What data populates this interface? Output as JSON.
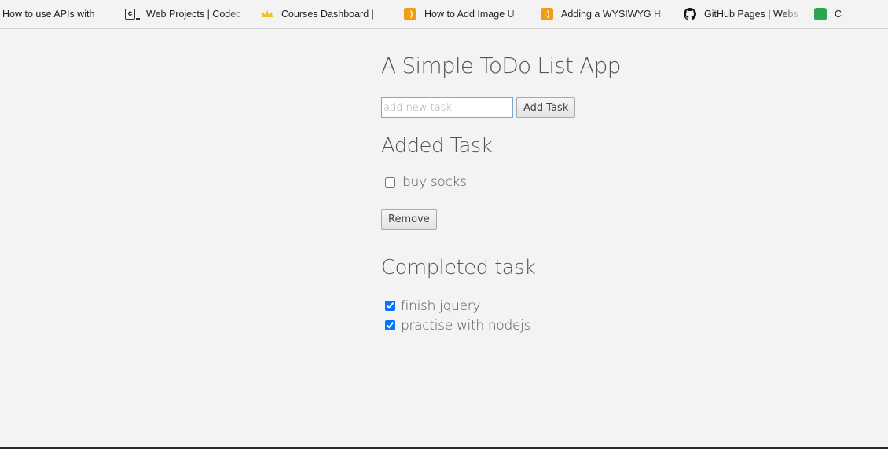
{
  "bookmarks": [
    {
      "label": "How to use APIs with",
      "icon": "none"
    },
    {
      "label": "Web Projects | Codec",
      "icon": "codecademy-icon"
    },
    {
      "label": "Courses Dashboard |",
      "icon": "crown-icon"
    },
    {
      "label": "How to Add Image U",
      "icon": "orange-bracket-icon"
    },
    {
      "label": "Adding a WYSIWYG H",
      "icon": "orange-bracket-icon"
    },
    {
      "label": "GitHub Pages | Webs",
      "icon": "github-icon"
    },
    {
      "label": "C",
      "icon": "green-bracket-icon"
    }
  ],
  "app": {
    "title": "A Simple ToDo List App",
    "new_task": {
      "placeholder": "add new task",
      "value": ""
    },
    "add_button": "Add Task",
    "added_heading": "Added Task",
    "added_tasks": [
      {
        "label": "buy socks",
        "checked": false
      }
    ],
    "remove_button": "Remove",
    "completed_heading": "Completed task",
    "completed_tasks": [
      {
        "label": "finish jquery",
        "checked": true
      },
      {
        "label": "practise with nodejs",
        "checked": true
      }
    ]
  },
  "colors": {
    "background": "#f3f3f3",
    "text": "#555555",
    "input_focus_border": "#7ea6d6",
    "orange_icon": "#f39c12",
    "green_icon": "#2ea44f"
  }
}
